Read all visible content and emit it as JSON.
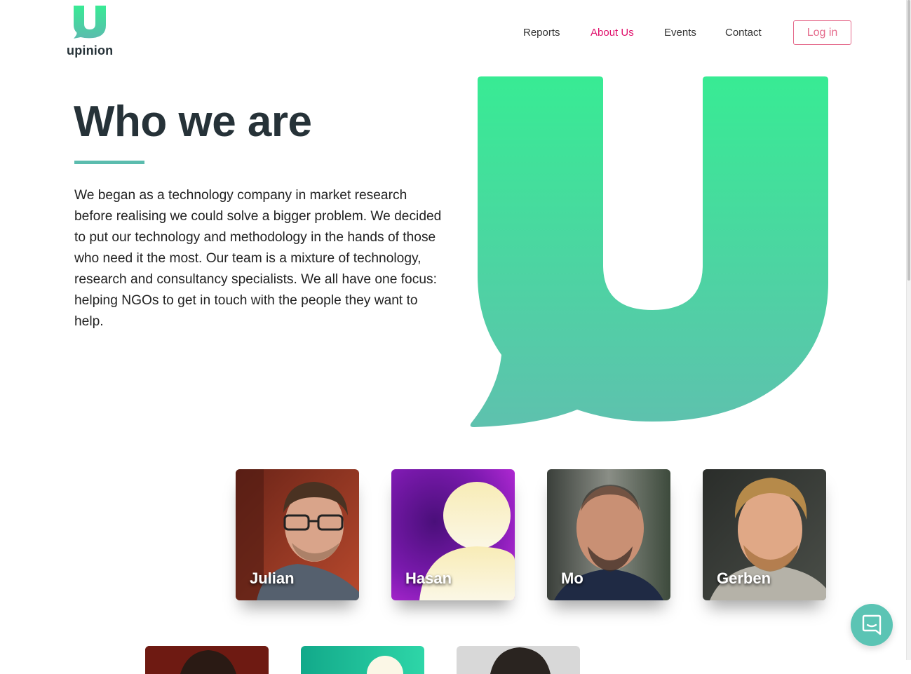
{
  "brand": {
    "name": "upinion",
    "color": "#2de39a"
  },
  "nav": {
    "items": [
      {
        "label": "Reports",
        "active": false
      },
      {
        "label": "About Us",
        "active": true
      },
      {
        "label": "Events",
        "active": false
      },
      {
        "label": "Contact",
        "active": false
      }
    ],
    "login_label": "Log in"
  },
  "hero": {
    "title": "Who we are",
    "body": "We began as a technology company in market research before realising we could solve a bigger problem. We decided to put our technology and methodology in the hands of those who need it the most. Our team is a mixture of technology, research and consultancy specialists. We all have one focus: helping NGOs to get in touch with the people they want to help."
  },
  "team": [
    {
      "name": "Julian"
    },
    {
      "name": "Hasan"
    },
    {
      "name": "Mo"
    },
    {
      "name": "Gerben"
    }
  ],
  "colors": {
    "accent": "#e0106b",
    "teal": "#5bbcae",
    "green": "#38eb94",
    "text": "#263238"
  },
  "icons": {
    "logo": "upinion-u-speech-bubble",
    "chat": "chat-bubble-icon"
  }
}
